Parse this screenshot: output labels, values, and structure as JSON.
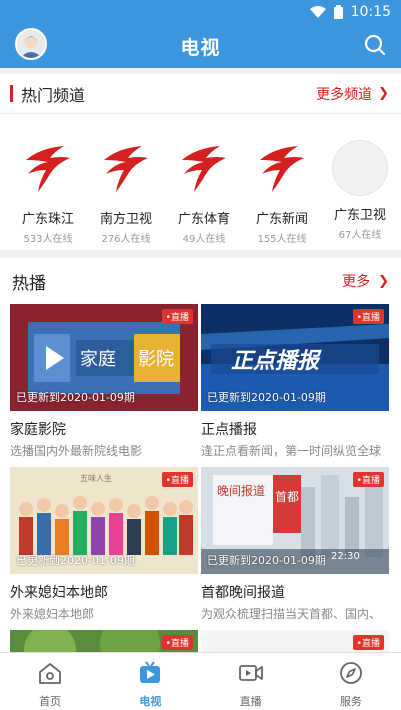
{
  "status": {
    "time": "10:15"
  },
  "appbar": {
    "title": "电视"
  },
  "hot_channels": {
    "title": "热门频道",
    "more_label": "更多频道",
    "items": [
      {
        "name": "广东珠江",
        "online": "533人在线"
      },
      {
        "name": "南方卫视",
        "online": "276人在线"
      },
      {
        "name": "广东体育",
        "online": "49人在线"
      },
      {
        "name": "广东新闻",
        "online": "155人在线"
      },
      {
        "name": "广东卫视",
        "online": "67人在线"
      }
    ]
  },
  "hot_play": {
    "title": "热播",
    "more_label": "更多",
    "items": [
      {
        "title": "家庭影院",
        "desc": "选播国内外最新院线电影",
        "updated": "已更新到2020-01-09期",
        "badge": "直播",
        "thumb_text_1": "家庭",
        "thumb_text_2": "影院"
      },
      {
        "title": "正点播报",
        "desc": "逢正点看新闻，第一时间纵览全球",
        "updated": "已更新到2020-01-09期",
        "badge": "直播",
        "thumb_text_1": "正点播报"
      },
      {
        "title": "外来媳妇本地郎",
        "desc": "外来媳妇本地郎",
        "updated": "已更新到2020-01-09期",
        "badge": "直播",
        "thumb_text_1": "五味人生"
      },
      {
        "title": "首都晚间报道",
        "desc": "为观众梳理扫描当天首都、国内、",
        "updated": "已更新到2020-01-09期",
        "badge": "直播",
        "thumb_text_1": "晚间报道",
        "thumb_text_2": "首都",
        "thumb_text_3": "22:30"
      },
      {
        "badge": "直播"
      },
      {
        "badge": "直播"
      }
    ]
  },
  "tabbar": {
    "items": [
      {
        "label": "首页"
      },
      {
        "label": "电视"
      },
      {
        "label": "直播"
      },
      {
        "label": "服务"
      }
    ]
  },
  "colors": {
    "primary": "#3d97de",
    "accent_red": "#d61f1f",
    "badge_red": "#e0342c"
  }
}
